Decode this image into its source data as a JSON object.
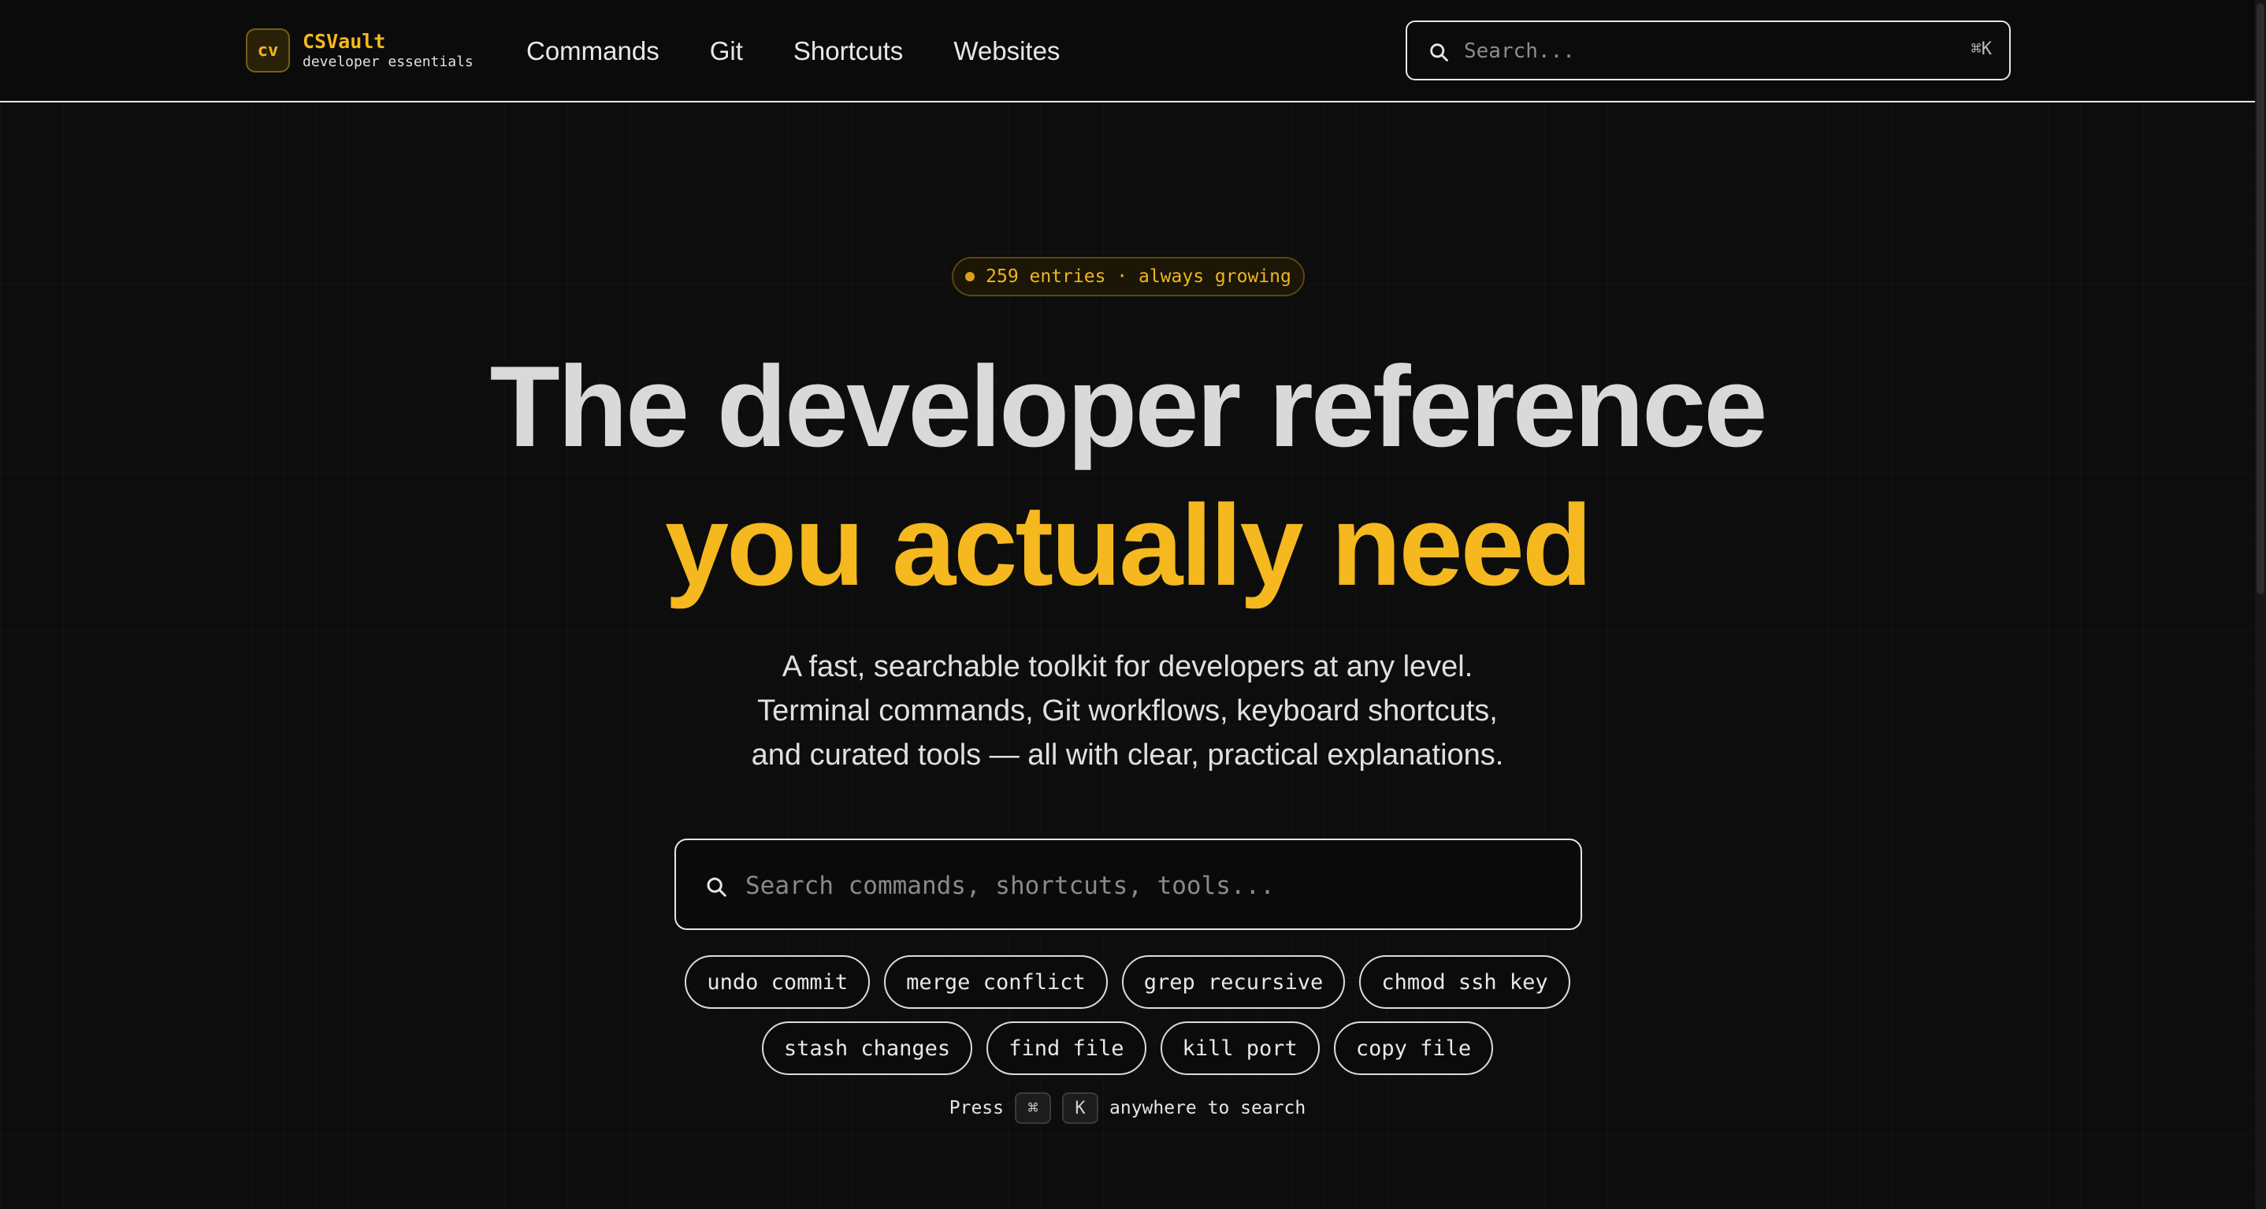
{
  "brand": {
    "logo_text": "cv",
    "name": "CSVault",
    "tagline": "developer essentials"
  },
  "nav": {
    "items": [
      {
        "label": "Commands"
      },
      {
        "label": "Git"
      },
      {
        "label": "Shortcuts"
      },
      {
        "label": "Websites"
      }
    ]
  },
  "header_search": {
    "placeholder": "Search...",
    "shortcut": "⌘K",
    "icon": "search-icon"
  },
  "hero": {
    "badge": "259 entries · always growing",
    "headline_line1": "The developer reference",
    "headline_line2": "you actually need",
    "description": [
      "A fast, searchable toolkit for developers at any level.",
      "Terminal commands, Git workflows, keyboard shortcuts,",
      "and curated tools — all with clear, practical explanations."
    ]
  },
  "main_search": {
    "placeholder": "Search commands, shortcuts, tools...",
    "icon": "search-icon"
  },
  "suggestions": {
    "row1": [
      "undo commit",
      "merge conflict",
      "grep recursive",
      "chmod ssh key"
    ],
    "row2": [
      "stash changes",
      "find file",
      "kill port",
      "copy file"
    ]
  },
  "hint": {
    "prefix": "Press",
    "key1": "⌘",
    "key2": "K",
    "suffix": "anywhere to search"
  },
  "colors": {
    "accent": "#f5b81e",
    "background": "#0d0d0d",
    "text": "#e6e6e6"
  }
}
